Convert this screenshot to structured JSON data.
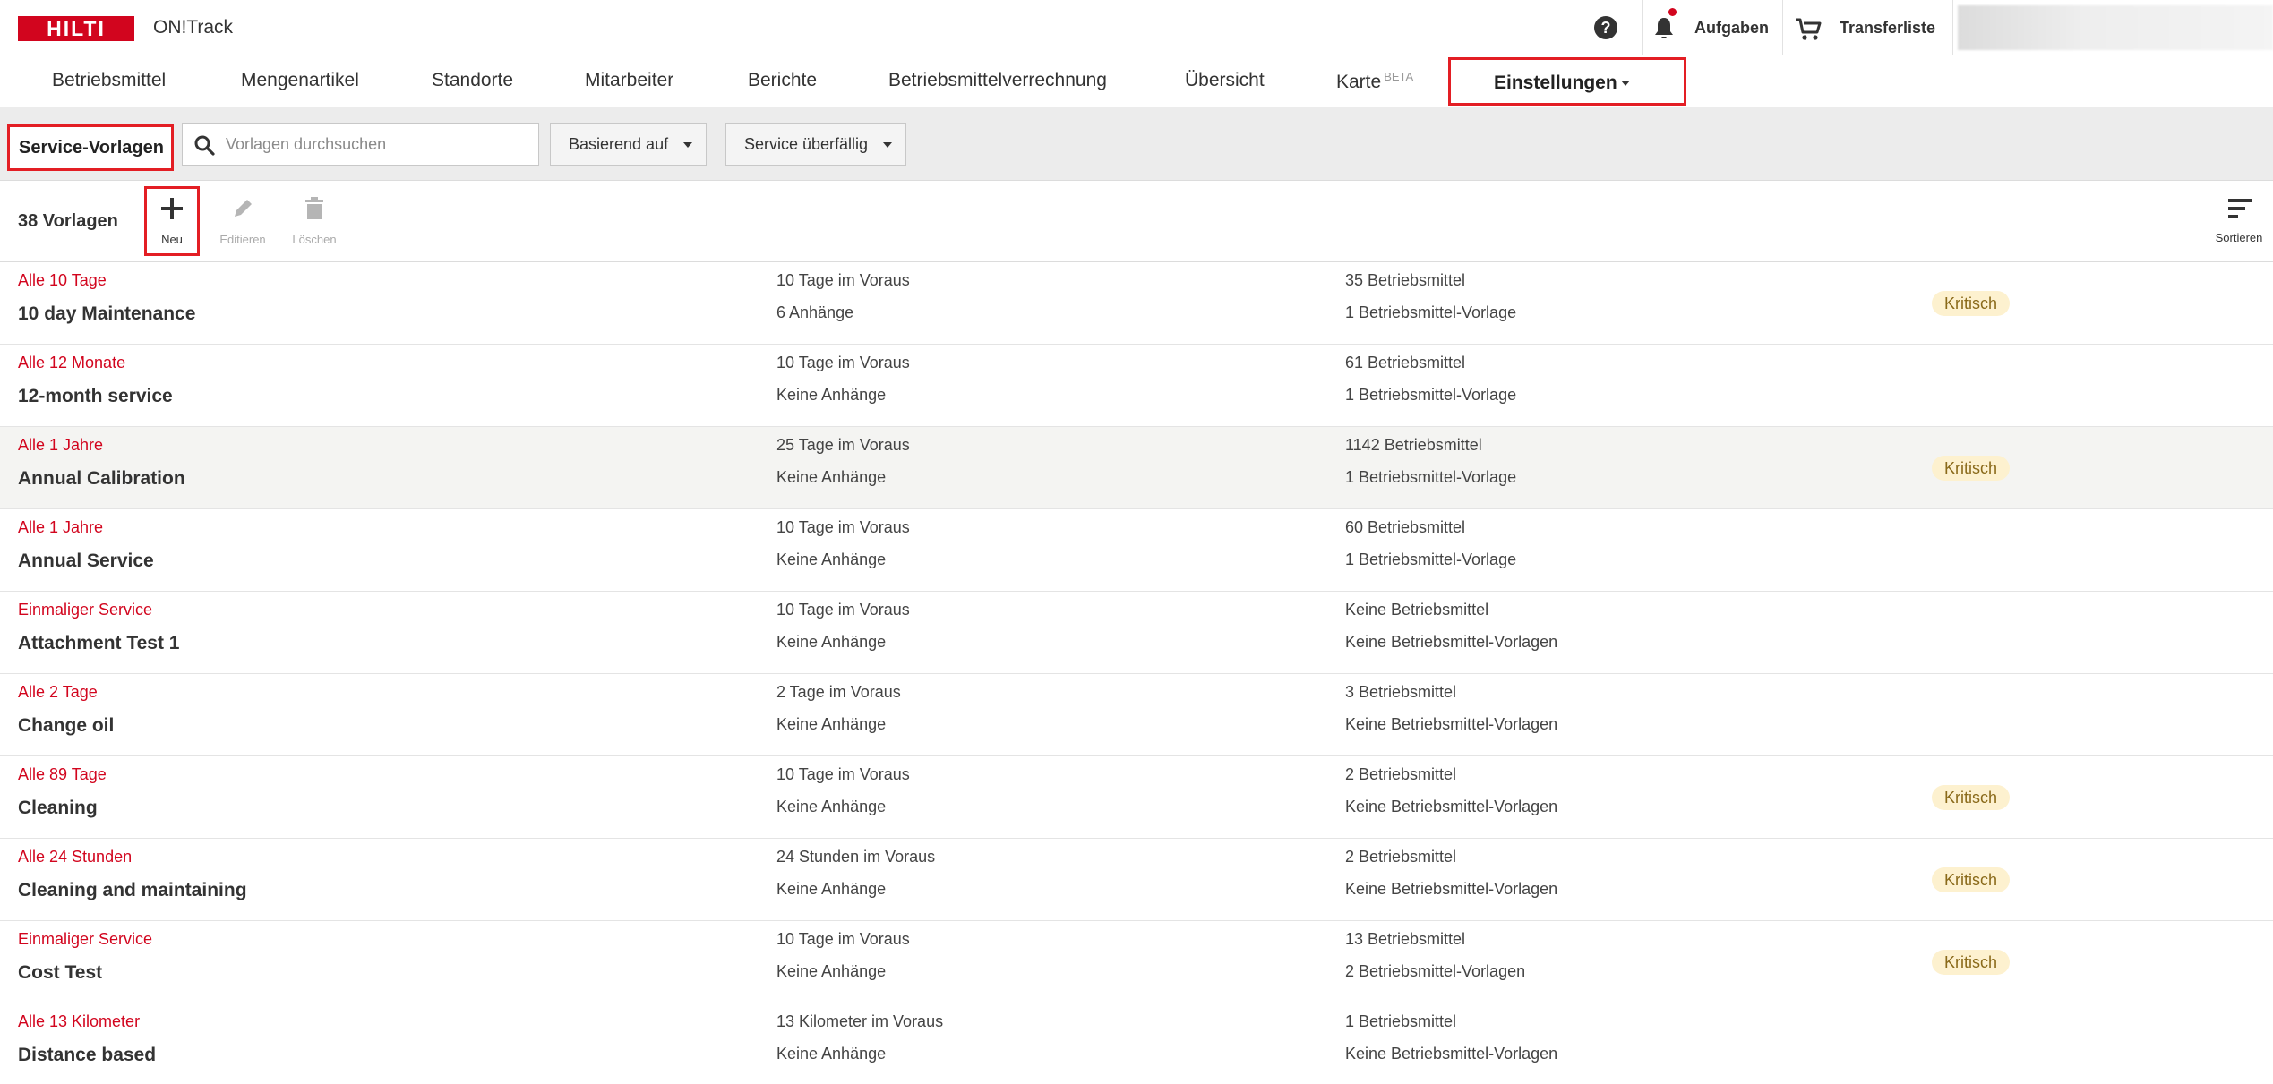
{
  "header": {
    "logo_text": "HILTI",
    "app_name": "ON!Track",
    "help_glyph": "?",
    "tasks_label": "Aufgaben",
    "transfer_label": "Transferliste",
    "icons": {
      "help": "help-icon",
      "bell": "bell-icon",
      "cart": "cart-icon"
    },
    "accent_color": "#d2051e"
  },
  "nav": {
    "items": [
      {
        "label": "Betriebsmittel"
      },
      {
        "label": "Mengenartikel"
      },
      {
        "label": "Standorte"
      },
      {
        "label": "Mitarbeiter"
      },
      {
        "label": "Berichte"
      },
      {
        "label": "Betriebsmittelverrechnung"
      },
      {
        "label": "Übersicht"
      },
      {
        "label": "Karte",
        "badge": "BETA"
      }
    ],
    "active": {
      "label": "Einstellungen"
    }
  },
  "filterbar": {
    "title": "Service-Vorlagen",
    "search_placeholder": "Vorlagen durchsuchen",
    "filters": [
      {
        "label": "Basierend auf"
      },
      {
        "label": "Service überfällig"
      }
    ]
  },
  "toolbar": {
    "count": "38 Vorlagen",
    "new_label": "Neu",
    "edit_label": "Editieren",
    "delete_label": "Löschen",
    "sort_label": "Sortieren"
  },
  "rows": [
    {
      "interval": "Alle 10 Tage",
      "name": "10 day Maintenance",
      "lead": "10 Tage im Voraus",
      "attachments": "6 Anhänge",
      "assets": "35 Betriebsmittel",
      "templates": "1 Betriebsmittel-Vorlage",
      "badge": "Kritisch"
    },
    {
      "interval": "Alle 12 Monate",
      "name": "12-month service",
      "lead": "10 Tage im Voraus",
      "attachments": "Keine Anhänge",
      "assets": "61 Betriebsmittel",
      "templates": "1 Betriebsmittel-Vorlage",
      "badge": ""
    },
    {
      "interval": "Alle 1 Jahre",
      "name": "Annual Calibration",
      "lead": "25 Tage im Voraus",
      "attachments": "Keine Anhänge",
      "assets": "1142 Betriebsmittel",
      "templates": "1 Betriebsmittel-Vorlage",
      "badge": "Kritisch"
    },
    {
      "interval": "Alle 1 Jahre",
      "name": "Annual Service",
      "lead": "10 Tage im Voraus",
      "attachments": "Keine Anhänge",
      "assets": "60 Betriebsmittel",
      "templates": "1 Betriebsmittel-Vorlage",
      "badge": ""
    },
    {
      "interval": "Einmaliger Service",
      "name": "Attachment Test 1",
      "lead": "10 Tage im Voraus",
      "attachments": "Keine Anhänge",
      "assets": "Keine Betriebsmittel",
      "templates": "Keine Betriebsmittel-Vorlagen",
      "badge": ""
    },
    {
      "interval": "Alle 2 Tage",
      "name": "Change oil",
      "lead": "2 Tage im Voraus",
      "attachments": "Keine Anhänge",
      "assets": "3 Betriebsmittel",
      "templates": "Keine Betriebsmittel-Vorlagen",
      "badge": ""
    },
    {
      "interval": "Alle 89 Tage",
      "name": "Cleaning",
      "lead": "10 Tage im Voraus",
      "attachments": "Keine Anhänge",
      "assets": "2 Betriebsmittel",
      "templates": "Keine Betriebsmittel-Vorlagen",
      "badge": "Kritisch"
    },
    {
      "interval": "Alle 24 Stunden",
      "name": "Cleaning and maintaining",
      "lead": "24 Stunden im Voraus",
      "attachments": "Keine Anhänge",
      "assets": "2 Betriebsmittel",
      "templates": "Keine Betriebsmittel-Vorlagen",
      "badge": "Kritisch"
    },
    {
      "interval": "Einmaliger Service",
      "name": "Cost Test",
      "lead": "10 Tage im Voraus",
      "attachments": "Keine Anhänge",
      "assets": "13 Betriebsmittel",
      "templates": "2 Betriebsmittel-Vorlagen",
      "badge": "Kritisch"
    },
    {
      "interval": "Alle 13 Kilometer",
      "name": "Distance based",
      "lead": "13 Kilometer im Voraus",
      "attachments": "Keine Anhänge",
      "assets": "1 Betriebsmittel",
      "templates": "Keine Betriebsmittel-Vorlagen",
      "badge": ""
    }
  ]
}
